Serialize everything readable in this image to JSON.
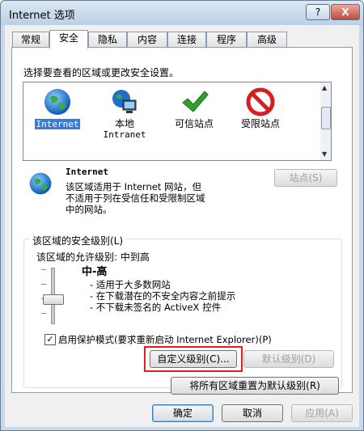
{
  "window": {
    "title": "Internet 选项",
    "help_label": "?",
    "close_label": "X"
  },
  "tabs": [
    {
      "label": "常规"
    },
    {
      "label": "安全"
    },
    {
      "label": "隐私"
    },
    {
      "label": "内容"
    },
    {
      "label": "连接"
    },
    {
      "label": "程序"
    },
    {
      "label": "高级"
    }
  ],
  "security": {
    "instruction": "选择要查看的区域或更改安全设置。",
    "zones": [
      {
        "label": "Internet",
        "icon": "globe-icon"
      },
      {
        "label": "本地",
        "label2": "Intranet",
        "icon": "local-intranet-icon"
      },
      {
        "label": "可信站点",
        "icon": "check-icon"
      },
      {
        "label": "受限站点",
        "icon": "restricted-icon"
      }
    ],
    "zone_name": "Internet",
    "zone_desc": [
      "该区域适用于 Internet 网站，但",
      "不适用于列在受信任和受限制区域",
      "中的网站。"
    ],
    "sites_button": "站点(S)",
    "level_group": "该区域的安全级别(L)",
    "allowed_levels": "该区域的允许级别: 中到高",
    "level_name": "中-高",
    "level_bullets": [
      "- 适用于大多数网站",
      "- 在下载潜在的不安全内容之前提示",
      "- 不下载未签名的 ActiveX 控件"
    ],
    "protected_mode": "启用保护模式(要求重新启动 Internet Explorer)(P)",
    "protected_mode_checked": true,
    "custom_level_button": "自定义级别(C)...",
    "default_level_button": "默认级别(D)",
    "reset_all_button": "将所有区域重置为默认级别(R)"
  },
  "footer": {
    "ok": "确定",
    "cancel": "取消",
    "apply": "应用(A)"
  },
  "colors": {
    "highlight": "#e02020",
    "selection": "#3b7bd1"
  }
}
